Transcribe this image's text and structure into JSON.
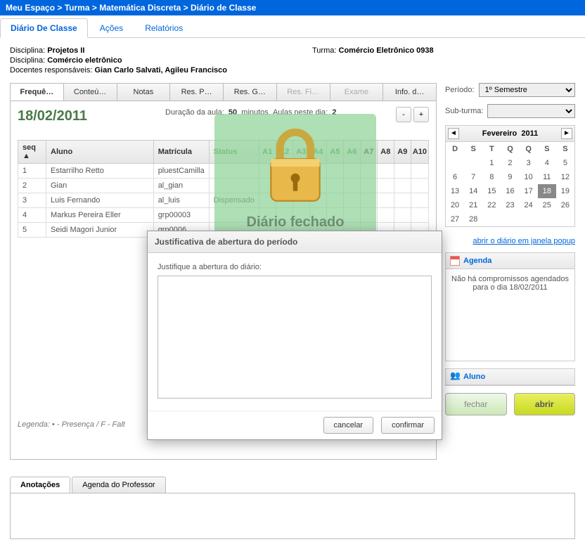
{
  "breadcrumb": [
    "Meu Espaço",
    "Turma",
    "Matemática Discreta",
    "Diário de Classe"
  ],
  "mainTabs": [
    {
      "label": "Diário De Classe",
      "active": true
    },
    {
      "label": "Ações",
      "active": false
    },
    {
      "label": "Relatórios",
      "active": false
    }
  ],
  "info": {
    "disc1_label": "Disciplina:",
    "disc1_value": "Projetos II",
    "turma_label": "Turma:",
    "turma_value": "Comércio Eletrônico 0938",
    "disc2_label": "Disciplina:",
    "disc2_value": "Comércio eletrônico",
    "doc_label": "Docentes responsáveis:",
    "doc_value": "Gian Carlo Salvati, Agileu Francisco"
  },
  "subTabs": [
    {
      "label": "Frequê…",
      "state": "active"
    },
    {
      "label": "Conteú…",
      "state": ""
    },
    {
      "label": "Notas",
      "state": ""
    },
    {
      "label": "Res. P…",
      "state": ""
    },
    {
      "label": "Res. G…",
      "state": ""
    },
    {
      "label": "Res. Fi…",
      "state": "disabled"
    },
    {
      "label": "Exame",
      "state": "disabled"
    },
    {
      "label": "Info. d…",
      "state": ""
    }
  ],
  "dateTitle": "18/02/2011",
  "duration": {
    "label1": "Duração da aula:",
    "v1": "50",
    "unit": "minutos",
    "label2": "Aulas neste dia:",
    "v2": "2"
  },
  "gridHeaders": {
    "seq": "seq ▲",
    "aluno": "Aluno",
    "matricula": "Matrícula",
    "status": "Status"
  },
  "aCols": [
    "A1",
    "A2",
    "A3",
    "A4",
    "A5",
    "A6",
    "A7",
    "A8",
    "A9",
    "A10"
  ],
  "rows": [
    {
      "seq": "1",
      "aluno": "Estarrilho Retto",
      "matricula": "pluestCamilla",
      "status": ""
    },
    {
      "seq": "2",
      "aluno": "Gian",
      "matricula": "al_gian",
      "status": ""
    },
    {
      "seq": "3",
      "aluno": "Luis Fernando",
      "matricula": "al_luis",
      "status": "Dispensado"
    },
    {
      "seq": "4",
      "aluno": "Markus Pereira Eller",
      "matricula": "grp00003",
      "status": ""
    },
    {
      "seq": "5",
      "aluno": "Seidi Magori Junior",
      "matricula": "grp0006",
      "status": ""
    }
  ],
  "legend": "Legenda:   • - Presença / F - Falt",
  "lockText": "Diário fechado",
  "modal": {
    "title": "Justificativa de abertura do período",
    "prompt": "Justifique a abertura do diário:",
    "cancel": "cancelar",
    "confirm": "confirmar"
  },
  "side": {
    "periodoLabel": "Período:",
    "periodoValue": "1º Semestre",
    "subturmaLabel": "Sub-turma:",
    "subturmaValue": ""
  },
  "calendar": {
    "month": "Fevereiro",
    "year": "2011",
    "dow": [
      "D",
      "S",
      "T",
      "Q",
      "Q",
      "S",
      "S"
    ],
    "weeks": [
      [
        "",
        "",
        "1",
        "2",
        "3",
        "4",
        "5"
      ],
      [
        "6",
        "7",
        "8",
        "9",
        "10",
        "11",
        "12"
      ],
      [
        "13",
        "14",
        "15",
        "16",
        "17",
        "18",
        "19"
      ],
      [
        "20",
        "21",
        "22",
        "23",
        "24",
        "25",
        "26"
      ],
      [
        "27",
        "28",
        "",
        "",
        "",
        "",
        ""
      ]
    ],
    "selected": "18"
  },
  "popupLink": "abrir o diário em janela popup",
  "agenda": {
    "title": "Agenda",
    "text": "Não há compromissos agendados para o dia 18/02/2011"
  },
  "alunoPanel": {
    "title": "Aluno"
  },
  "actions": {
    "close": "fechar",
    "open": "abrir"
  },
  "bottomTabs": [
    {
      "label": "Anotações",
      "active": true
    },
    {
      "label": "Agenda do Professor",
      "active": false
    }
  ]
}
